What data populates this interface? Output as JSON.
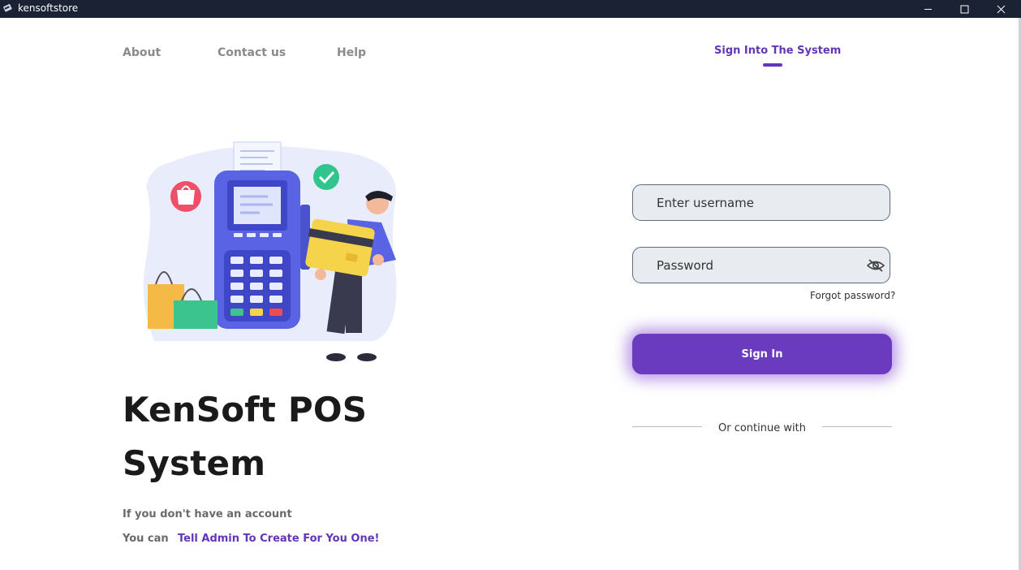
{
  "window": {
    "title": "kensoftstore"
  },
  "nav": {
    "about": "About",
    "contact": "Contact us",
    "help": "Help",
    "signin_tab": "Sign Into The System"
  },
  "hero": {
    "title_line1": "KenSoft POS",
    "title_line2": "System",
    "account_text": "If you don't have an account",
    "you_can": "You can",
    "admin_link": "Tell Admin To Create For You One!"
  },
  "form": {
    "username_placeholder": "Enter username",
    "password_placeholder": "Password",
    "forgot": "Forgot password?",
    "signin_button": "Sign In",
    "continue_with": "Or continue with"
  },
  "colors": {
    "accent": "#6335b8",
    "titlebar": "#1b2233",
    "field_bg": "#e8ecf0"
  }
}
